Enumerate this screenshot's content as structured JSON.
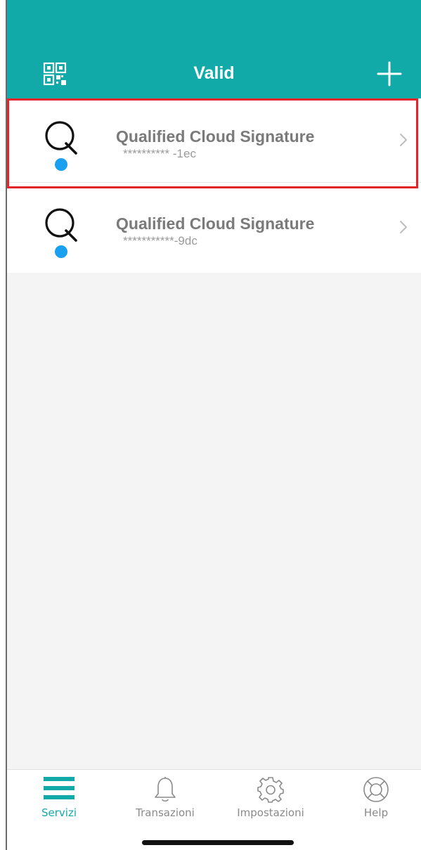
{
  "header": {
    "title": "Valid",
    "qr_icon": "qr-code-icon",
    "add_icon": "plus-icon",
    "background": "#12aaa8"
  },
  "services": [
    {
      "title": "Qualified Cloud Signature",
      "subtitle": "********** -1ec",
      "logo_icon": "q-logo-icon",
      "status_color": "#1aa0f0",
      "highlighted": true
    },
    {
      "title": "Qualified Cloud Signature",
      "subtitle": "***********-9dc",
      "logo_icon": "q-logo-icon",
      "status_color": "#1aa0f0",
      "highlighted": false
    }
  ],
  "highlight_color": "#e3242b",
  "tabbar": {
    "tabs": [
      {
        "label": "Servizi",
        "icon": "menu-icon",
        "active": true
      },
      {
        "label": "Transazioni",
        "icon": "bell-icon",
        "active": false
      },
      {
        "label": "Impostazioni",
        "icon": "gear-icon",
        "active": false
      },
      {
        "label": "Help",
        "icon": "lifebuoy-icon",
        "active": false
      }
    ],
    "active_color": "#12aaa8"
  }
}
